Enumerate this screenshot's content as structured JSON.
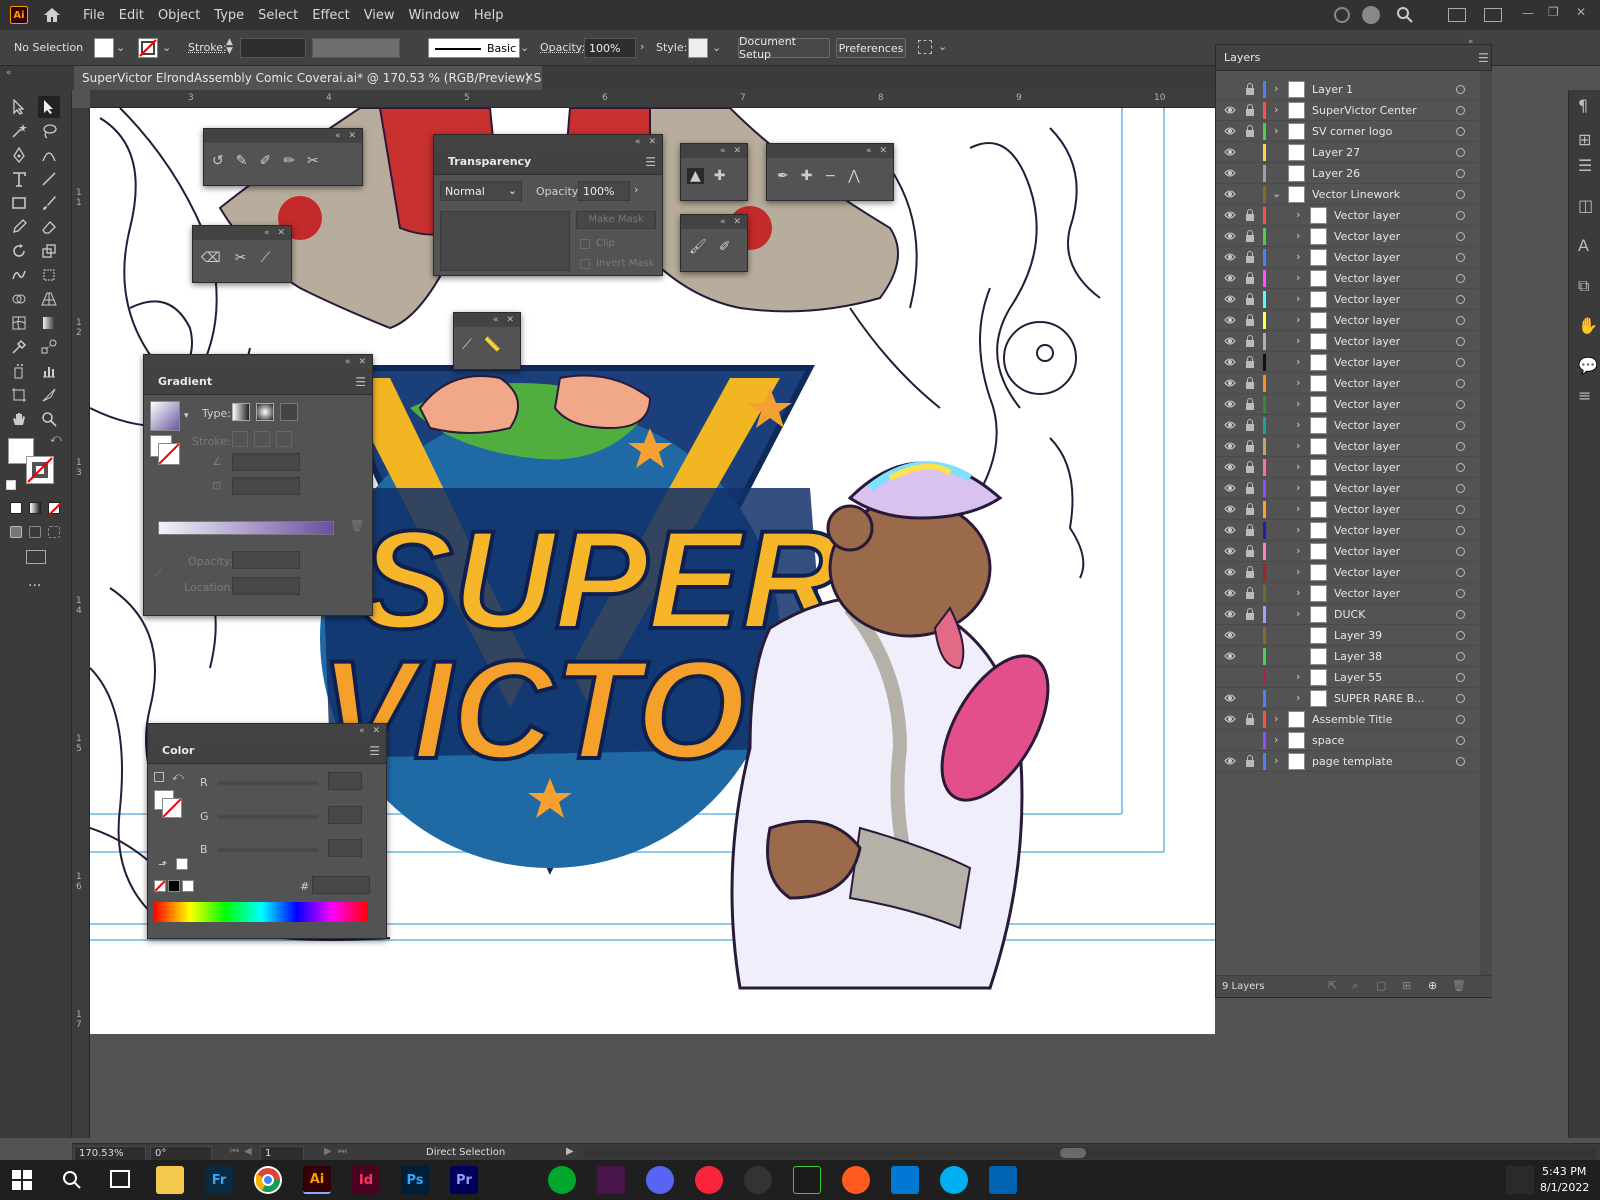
{
  "menubar": {
    "logo": "Ai",
    "items": [
      "File",
      "Edit",
      "Object",
      "Type",
      "Select",
      "Effect",
      "View",
      "Window",
      "Help"
    ]
  },
  "controlbar": {
    "selection": "No Selection",
    "stroke_label": "Stroke:",
    "brush_label": "Basic",
    "opacity_label": "Opacity:",
    "opacity_value": "100%",
    "style_label": "Style:",
    "document_setup": "Document Setup",
    "preferences": "Preferences"
  },
  "document_tab": {
    "title": "SuperVictor ElrondAssembly Comic Coverai.ai* @ 170.53 % (RGB/Preview) Saving...",
    "close": "×"
  },
  "rulers": {
    "h": [
      "3",
      "4",
      "5",
      "6",
      "7",
      "8",
      "9",
      "10"
    ],
    "v": [
      "1\n1",
      "1\n2",
      "1\n3",
      "1\n4",
      "1\n5",
      "1\n6",
      "1\n7"
    ]
  },
  "transparency_panel": {
    "title": "Transparency",
    "blend_mode": "Normal",
    "opacity_label": "Opacity:",
    "opacity_value": "100%",
    "make_mask": "Make Mask",
    "clip": "Clip",
    "invert_mask": "Invert Mask"
  },
  "gradient_panel": {
    "title": "Gradient",
    "type_label": "Type:",
    "stroke_label": "Stroke:",
    "opacity_label": "Opacity:",
    "location_label": "Location:"
  },
  "color_panel": {
    "title": "Color",
    "r_label": "R",
    "g_label": "G",
    "b_label": "B",
    "hex_label": "#"
  },
  "layers_panel": {
    "title": "Layers",
    "footer_count": "9 Layers",
    "layers": [
      {
        "name": "Layer 1",
        "color": "#4f7fff",
        "eye": false,
        "lock": true,
        "expand": true,
        "indent": 0
      },
      {
        "name": "SuperVictor Center",
        "color": "#ff4f4f",
        "eye": true,
        "lock": true,
        "expand": true,
        "indent": 0
      },
      {
        "name": "SV corner logo",
        "color": "#4fcf4f",
        "eye": true,
        "lock": true,
        "expand": true,
        "indent": 0
      },
      {
        "name": "Layer 27",
        "color": "#ffd24f",
        "eye": true,
        "lock": false,
        "expand": false,
        "indent": 0
      },
      {
        "name": "Layer 26",
        "color": "#a0a0a0",
        "eye": true,
        "lock": false,
        "expand": false,
        "indent": 0
      },
      {
        "name": "Vector Linework",
        "color": "#8a6a2a",
        "eye": true,
        "lock": false,
        "expand": "open",
        "indent": 0
      },
      {
        "name": "Vector layer",
        "color": "#ff4f4f",
        "eye": true,
        "lock": true,
        "expand": true,
        "indent": 1
      },
      {
        "name": "Vector layer",
        "color": "#4fcf4f",
        "eye": true,
        "lock": true,
        "expand": true,
        "indent": 1
      },
      {
        "name": "Vector layer",
        "color": "#4f7fff",
        "eye": true,
        "lock": true,
        "expand": true,
        "indent": 1
      },
      {
        "name": "Vector layer",
        "color": "#ff4fff",
        "eye": true,
        "lock": true,
        "expand": true,
        "indent": 1
      },
      {
        "name": "Vector layer",
        "color": "#4fffff",
        "eye": true,
        "lock": true,
        "expand": true,
        "indent": 1
      },
      {
        "name": "Vector layer",
        "color": "#ffff4f",
        "eye": true,
        "lock": true,
        "expand": true,
        "indent": 1
      },
      {
        "name": "Vector layer",
        "color": "#b0b0b0",
        "eye": true,
        "lock": true,
        "expand": true,
        "indent": 1
      },
      {
        "name": "Vector layer",
        "color": "#111111",
        "eye": true,
        "lock": true,
        "expand": true,
        "indent": 1
      },
      {
        "name": "Vector layer",
        "color": "#ff8f1f",
        "eye": true,
        "lock": true,
        "expand": true,
        "indent": 1
      },
      {
        "name": "Vector layer",
        "color": "#2f8f2f",
        "eye": true,
        "lock": true,
        "expand": true,
        "indent": 1
      },
      {
        "name": "Vector layer",
        "color": "#1f9f9f",
        "eye": true,
        "lock": true,
        "expand": true,
        "indent": 1
      },
      {
        "name": "Vector layer",
        "color": "#c8a070",
        "eye": true,
        "lock": true,
        "expand": true,
        "indent": 1
      },
      {
        "name": "Vector layer",
        "color": "#ff6fa0",
        "eye": true,
        "lock": true,
        "expand": true,
        "indent": 1
      },
      {
        "name": "Vector layer",
        "color": "#8f4fff",
        "eye": true,
        "lock": true,
        "expand": true,
        "indent": 1
      },
      {
        "name": "Vector layer",
        "color": "#ff9f2f",
        "eye": true,
        "lock": true,
        "expand": true,
        "indent": 1
      },
      {
        "name": "Vector layer",
        "color": "#1f1faf",
        "eye": true,
        "lock": true,
        "expand": true,
        "indent": 1
      },
      {
        "name": "Vector layer",
        "color": "#ff7fbf",
        "eye": true,
        "lock": true,
        "expand": true,
        "indent": 1
      },
      {
        "name": "Vector layer",
        "color": "#b01f1f",
        "eye": true,
        "lock": true,
        "expand": true,
        "indent": 1
      },
      {
        "name": "Vector layer",
        "color": "#6f6f1f",
        "eye": true,
        "lock": true,
        "expand": true,
        "indent": 1
      },
      {
        "name": "DUCK",
        "color": "#9f9fff",
        "eye": true,
        "lock": true,
        "expand": true,
        "indent": 1
      },
      {
        "name": "Layer 39",
        "color": "#8a6a2a",
        "eye": true,
        "lock": false,
        "expand": false,
        "indent": 1
      },
      {
        "name": "Layer 38",
        "color": "#4fcf4f",
        "eye": true,
        "lock": false,
        "expand": false,
        "indent": 1
      },
      {
        "name": "Layer 55",
        "color": "#b01f4f",
        "eye": false,
        "lock": false,
        "expand": true,
        "indent": 1
      },
      {
        "name": "SUPER RARE B...",
        "color": "#4f7fff",
        "eye": true,
        "lock": false,
        "expand": true,
        "indent": 1
      },
      {
        "name": "Assemble Title",
        "color": "#ff4f4f",
        "eye": true,
        "lock": true,
        "expand": true,
        "indent": 0
      },
      {
        "name": "space",
        "color": "#8f4fff",
        "eye": false,
        "lock": false,
        "expand": true,
        "indent": 0
      },
      {
        "name": "page template",
        "color": "#4f7fff",
        "eye": true,
        "lock": true,
        "expand": true,
        "indent": 0
      }
    ]
  },
  "statusbar": {
    "zoom": "170.53%",
    "rotation": "0°",
    "artboard": "1",
    "tool": "Direct Selection"
  },
  "taskbar": {
    "apps": [
      {
        "label": "Fr",
        "color": "#0a2a3f",
        "fg": "#2fa7ff"
      },
      {
        "label": "",
        "color": "#ffffff",
        "fg": "#000"
      },
      {
        "label": "Ai",
        "color": "#330000",
        "fg": "#ff9a00"
      },
      {
        "label": "Id",
        "color": "#49021f",
        "fg": "#ff3366"
      },
      {
        "label": "Ps",
        "color": "#001e36",
        "fg": "#31a8ff"
      },
      {
        "label": "Pr",
        "color": "#00005b",
        "fg": "#9999ff"
      }
    ],
    "time": "5:43 PM",
    "date": "8/1/2022"
  },
  "art": {
    "logo_word1": "SUPER",
    "logo_word2": "VICTOR"
  }
}
